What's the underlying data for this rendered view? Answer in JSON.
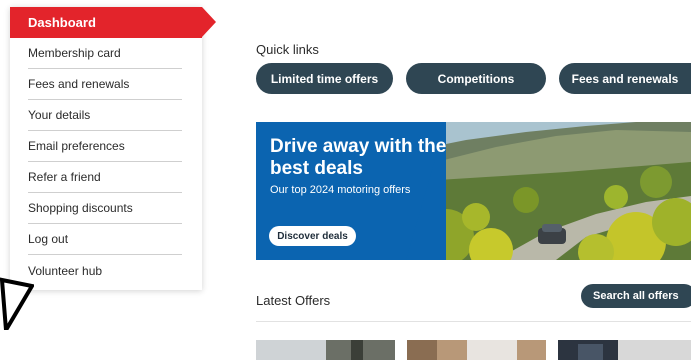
{
  "sidebar": {
    "active": "Dashboard",
    "items": [
      "Membership card",
      "Fees and renewals",
      "Your details",
      "Email preferences",
      "Refer a friend",
      "Shopping discounts",
      "Log out",
      "Volunteer hub"
    ]
  },
  "quick_links": {
    "title": "Quick links",
    "buttons": [
      "Limited time offers",
      "Competitions",
      "Fees and renewals"
    ]
  },
  "banner": {
    "headline": "Drive away with the best deals",
    "subtext": "Our top 2024 motoring offers",
    "cta": "Discover deals"
  },
  "latest_offers": {
    "title": "Latest Offers",
    "search_button": "Search all offers"
  },
  "colors": {
    "accent_red": "#e3242b",
    "nav_dark": "#2f4653",
    "banner_blue": "#0b64b0"
  },
  "icons": [
    "cursor-arrow-icon"
  ]
}
